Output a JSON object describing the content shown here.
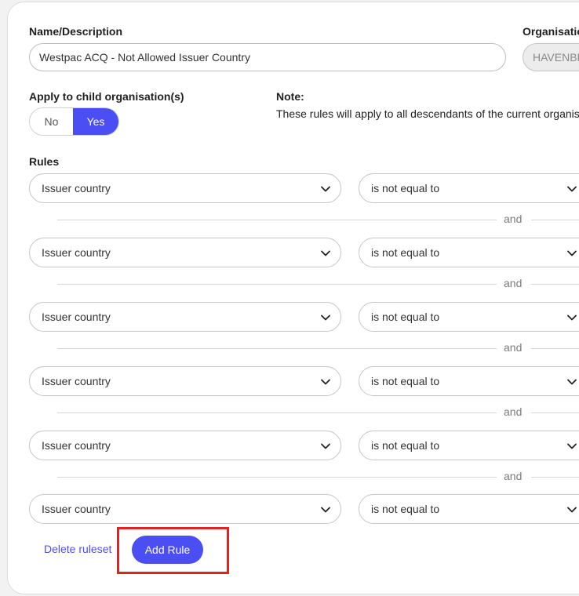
{
  "form": {
    "name_label": "Name/Description",
    "name_value": "Westpac ACQ - Not Allowed Issuer Country",
    "org_label": "Organisation",
    "org_value": "HAVENBROOK",
    "child_label": "Apply to child organisation(s)",
    "toggle": {
      "no": "No",
      "yes": "Yes",
      "selected": "Yes"
    },
    "note_title": "Note:",
    "note_text": "These rules will apply to all descendants of the current organisation"
  },
  "rules": {
    "label": "Rules",
    "connector": "and",
    "items": [
      {
        "field": "Issuer country",
        "operator": "is not equal to"
      },
      {
        "field": "Issuer country",
        "operator": "is not equal to"
      },
      {
        "field": "Issuer country",
        "operator": "is not equal to"
      },
      {
        "field": "Issuer country",
        "operator": "is not equal to"
      },
      {
        "field": "Issuer country",
        "operator": "is not equal to"
      },
      {
        "field": "Issuer country",
        "operator": "is not equal to"
      }
    ]
  },
  "actions": {
    "delete_label": "Delete ruleset",
    "add_label": "Add Rule"
  },
  "colors": {
    "accent": "#4b4ef2",
    "highlight": "#e0241f"
  }
}
